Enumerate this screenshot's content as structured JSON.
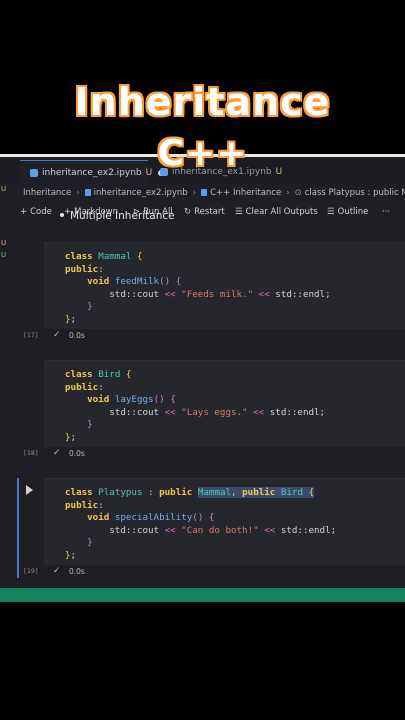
{
  "overlay": {
    "title_line1": "Inheritance",
    "title_line2": "C++"
  },
  "tabs": [
    {
      "label": "inheritance_ex2.ipynb",
      "badge": "U",
      "active": true
    },
    {
      "label": "inheritance_ex1.ipynb",
      "badge": "U",
      "active": false
    }
  ],
  "breadcrumb": {
    "items": [
      "Inheritance",
      "inheritance_ex2.ipynb",
      "C++ Inheritance",
      "class Platypus : public Mammal,"
    ]
  },
  "toolbar": {
    "code": "Code",
    "markdown": "Markdown",
    "run_all": "Run All",
    "restart": "Restart",
    "clear_outputs": "Clear All Outputs",
    "outline": "Outline",
    "more": "···"
  },
  "gutter_markers": [
    "U",
    "U",
    "U"
  ],
  "markdown": {
    "bullet": "Multiple Inheritance"
  },
  "cells": [
    {
      "exec_count": "[17]",
      "duration": "0.0s",
      "lines": [
        "class Mammal {",
        "public:",
        "    void feedMilk() {",
        "        std::cout << \"Feeds milk.\" << std::endl;",
        "    }",
        "};"
      ]
    },
    {
      "exec_count": "[18]",
      "duration": "0.0s",
      "lines": [
        "class Bird {",
        "public:",
        "    void layEggs() {",
        "        std::cout << \"Lays eggs.\" << std::endl;",
        "    }",
        "};"
      ]
    },
    {
      "exec_count": "[19]",
      "duration": "0.0s",
      "lines": [
        "class Platypus : public Mammal, public Bird {",
        "public:",
        "    void specialAbility() {",
        "        std::cout << \"Can do both!\" << std::endl;",
        "    }",
        "};"
      ]
    }
  ],
  "colors": {
    "keyword": "#f2c94c",
    "type": "#4ec9b0",
    "string": "#ce7e6a",
    "function": "#7aa8e6",
    "statusbar": "#16825d",
    "title_outline": "#ff9d3a"
  }
}
